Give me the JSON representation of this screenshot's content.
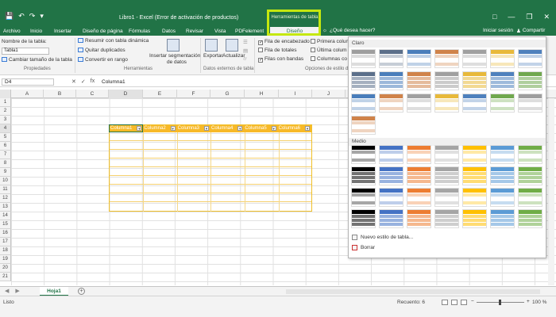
{
  "titlebar": {
    "window_title": "Libro1 - Excel (Error de activación de productos)",
    "contextual_tools_label": "Herramientas de tabla",
    "qat_icons": [
      "save-icon",
      "undo-icon",
      "redo-icon",
      "customize-icon"
    ]
  },
  "tabs": {
    "items": [
      "Archivo",
      "Inicio",
      "Insertar",
      "Diseño de página",
      "Fórmulas",
      "Datos",
      "Revisar",
      "Vista",
      "PDFelement"
    ],
    "active": "Diseño",
    "tell_me": "¿Qué desea hacer?",
    "sign_in": "Iniciar sesión",
    "share": "Compartir"
  },
  "ribbon": {
    "properties": {
      "table_name_label": "Nombre de la tabla:",
      "table_name_value": "Tabla1",
      "resize": "Cambiar tamaño de la tabla",
      "group": "Propiedades"
    },
    "tools": {
      "pivot": "Resumir con tabla dinámica",
      "remove_dupes": "Quitar duplicados",
      "convert": "Convertir en rango",
      "slicer_line1": "Insertar segmentación",
      "slicer_line2": "de datos",
      "group": "Herramientas"
    },
    "external": {
      "export": "Exportar",
      "refresh": "Actualizar",
      "group": "Datos externos de tabla"
    },
    "style_options": {
      "header_row": "Fila de encabezado",
      "total_row": "Fila de totales",
      "banded_rows": "Filas con bandas",
      "first_column": "Primera colum",
      "last_column": "Última colum",
      "banded_columns": "Columnas co",
      "group": "Opciones de estilo de"
    }
  },
  "formula_bar": {
    "name_box": "D4",
    "fx": "fx",
    "content": "Columna1"
  },
  "grid": {
    "columns": [
      "A",
      "B",
      "C",
      "D",
      "E",
      "F",
      "G",
      "H",
      "I",
      "J"
    ],
    "rows": [
      "1",
      "2",
      "3",
      "4",
      "5",
      "6",
      "7",
      "8",
      "9",
      "10",
      "11",
      "12",
      "13",
      "14",
      "15",
      "16",
      "17",
      "18",
      "19",
      "20",
      "21"
    ],
    "table_headers": [
      "Columna1",
      "Columna2",
      "Columna3",
      "Columna4",
      "Columna5",
      "Columna6"
    ]
  },
  "gallery": {
    "light_label": "Claro",
    "medium_label": "Medio",
    "new_style": "Nuevo estilo de tabla...",
    "clear": "Borrar",
    "light_colors": [
      "#9e9e9e",
      "#5b6f8a",
      "#4a7ebb",
      "#d0834a",
      "#a0a0a0",
      "#e8b93a",
      "#4f81bd",
      "#70a84e"
    ],
    "medium_colors": [
      "#000000",
      "#4472c4",
      "#ed7d31",
      "#a5a5a5",
      "#ffc000",
      "#5b9bd5",
      "#70ad47"
    ]
  },
  "sheets": {
    "active": "Hoja1"
  },
  "status": {
    "ready": "Listo",
    "count": "Recuento: 6",
    "zoom": "100 %"
  }
}
